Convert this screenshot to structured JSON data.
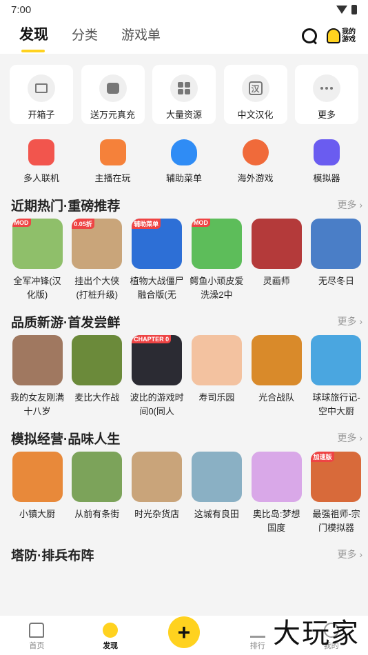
{
  "status": {
    "time": "7:00"
  },
  "nav": {
    "tabs": [
      "发现",
      "分类",
      "游戏单"
    ],
    "my_game_label": "我的游戏"
  },
  "features": [
    {
      "label": "开箱子",
      "icon": "box-icon"
    },
    {
      "label": "送万元真充",
      "icon": "money-icon"
    },
    {
      "label": "大量资源",
      "icon": "grid-icon"
    },
    {
      "label": "中文汉化",
      "icon": "han-icon"
    },
    {
      "label": "更多",
      "icon": "more-dots-icon"
    }
  ],
  "categories": [
    {
      "label": "多人联机",
      "icon": "multiplayer-icon",
      "color": "#f2554d"
    },
    {
      "label": "主播在玩",
      "icon": "streamer-icon",
      "color": "#f5813a"
    },
    {
      "label": "辅助菜单",
      "icon": "fire-icon",
      "color": "#2f8cf5"
    },
    {
      "label": "海外游戏",
      "icon": "planet-icon",
      "color": "#f06a3a"
    },
    {
      "label": "模拟器",
      "icon": "gamepad-icon",
      "color": "#6a5cf0"
    }
  ],
  "sections": [
    {
      "title": "近期热门·重磅推荐",
      "more": "更多",
      "games": [
        {
          "name": "全军冲锋(汉化版)",
          "badge": "MOD",
          "color": "#8fbf6a"
        },
        {
          "name": "挂出个大侠(打桩升级)",
          "badge": "0.05折",
          "color": "#c9a57a"
        },
        {
          "name": "植物大战僵尸融合版(无",
          "badge": "辅助菜单",
          "color": "#2d6fd6"
        },
        {
          "name": "鳄鱼小顽皮爱洗澡2中",
          "badge": "MOD",
          "color": "#5dbd5a"
        },
        {
          "name": "灵画师",
          "badge": "",
          "color": "#b43a3a"
        },
        {
          "name": "无尽冬日",
          "badge": "",
          "color": "#4a7ec7"
        }
      ]
    },
    {
      "title": "品质新游·首发尝鲜",
      "more": "更多",
      "games": [
        {
          "name": "我的女友刚满十八岁",
          "badge": "",
          "color": "#a07860"
        },
        {
          "name": "麦比大作战",
          "badge": "",
          "color": "#6b8a3a"
        },
        {
          "name": "波比的游戏时间0(同人",
          "badge": "CHAPTER 0",
          "color": "#2b2b33"
        },
        {
          "name": "寿司乐园",
          "badge": "",
          "color": "#f3c2a0"
        },
        {
          "name": "光合战队",
          "badge": "",
          "color": "#d98a2a"
        },
        {
          "name": "球球旅行记-空中大厨",
          "badge": "",
          "color": "#4aa6e0"
        }
      ]
    },
    {
      "title": "模拟经营·品味人生",
      "more": "更多",
      "games": [
        {
          "name": "小镇大厨",
          "badge": "",
          "color": "#e8893a"
        },
        {
          "name": "从前有条街",
          "badge": "",
          "color": "#7ca35a"
        },
        {
          "name": "时光杂货店",
          "badge": "",
          "color": "#c9a47a"
        },
        {
          "name": "这城有良田",
          "badge": "",
          "color": "#8ab0c4"
        },
        {
          "name": "奥比岛:梦想国度",
          "badge": "",
          "color": "#d9a8e8"
        },
        {
          "name": "最强祖师-宗门模拟器",
          "badge": "加速版",
          "color": "#d86a3a"
        }
      ]
    },
    {
      "title": "塔防·排兵布阵",
      "more": "更多",
      "games": []
    }
  ],
  "bottom_nav": [
    "首页",
    "发现",
    "",
    "排行",
    "我的"
  ],
  "watermark": "大玩家"
}
